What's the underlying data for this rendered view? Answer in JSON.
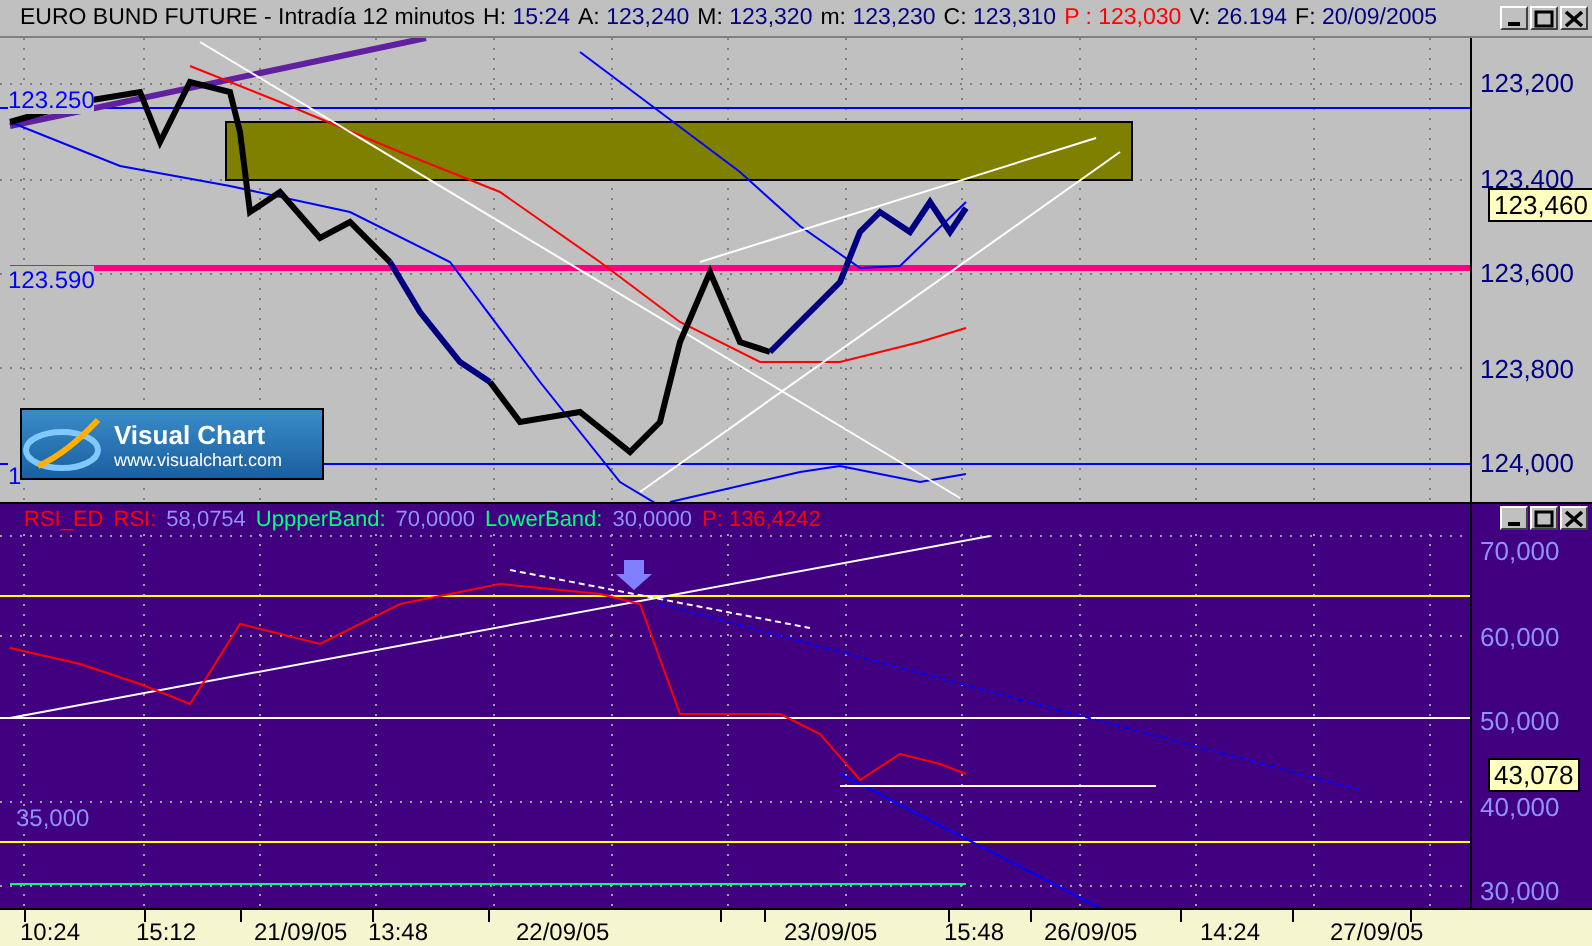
{
  "window": {
    "title": "EURO BUND FUTURE - Intradía 12 minutos",
    "quote": [
      {
        "label": "H:",
        "value": "15:24",
        "kind": "plain"
      },
      {
        "label": "A:",
        "value": "123,240",
        "kind": "plain"
      },
      {
        "label": "M:",
        "value": "123,320",
        "kind": "plain"
      },
      {
        "label": "m:",
        "value": "123,230",
        "kind": "plain"
      },
      {
        "label": "C:",
        "value": "123,310",
        "kind": "plain"
      },
      {
        "label": "P :",
        "value": "123,030",
        "kind": "alert"
      },
      {
        "label": "V:",
        "value": "26.194",
        "kind": "plain"
      },
      {
        "label": "F:",
        "value": "20/09/2005",
        "kind": "plain"
      }
    ]
  },
  "price_panel": {
    "axis_ticks": [
      "123,200",
      "123,400",
      "123,600",
      "123,800",
      "124,000"
    ],
    "current_price": "123,460",
    "level_labels": [
      {
        "text": "123.250",
        "kind": "upper"
      },
      {
        "text": "123.590",
        "kind": "middle"
      },
      {
        "text": "1",
        "kind": "lower"
      }
    ],
    "logo": {
      "name": "Visual Chart",
      "url": "www.visualchart.com"
    }
  },
  "indicator_panel": {
    "header": [
      {
        "text": "RSI_ED",
        "color": "#ff0000"
      },
      {
        "text": "RSI:",
        "color": "#ff0000"
      },
      {
        "text": "58,0754",
        "color": "#9090ff"
      },
      {
        "text": "UppperBand:",
        "color": "#00ff80"
      },
      {
        "text": "70,0000",
        "color": "#9090ff"
      },
      {
        "text": "LowerBand:",
        "color": "#00ff80"
      },
      {
        "text": "30,0000",
        "color": "#9090ff"
      },
      {
        "text": "P: 136,4242",
        "color": "#ff0000"
      }
    ],
    "axis_ticks": [
      "70,000",
      "60,000",
      "50,000",
      "40,000",
      "30,000"
    ],
    "current_value": "43,078",
    "level_label": "35,000"
  },
  "time_axis": [
    "10:24",
    "15:12",
    "21/09/05",
    "13:48",
    "22/09/05",
    "23/09/05",
    "15:48",
    "26/09/05",
    "14:24",
    "27/09/05"
  ]
}
